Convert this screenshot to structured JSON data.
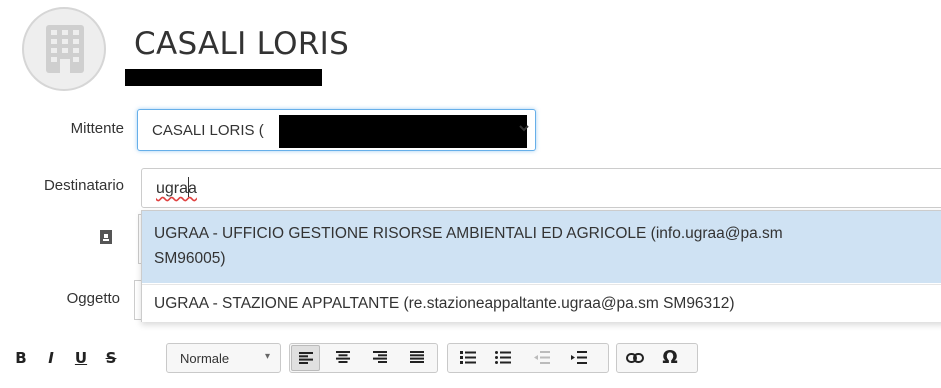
{
  "header": {
    "name": "CASALI LORIS",
    "avatar_icon": "building-icon"
  },
  "form": {
    "mittente_label": "Mittente",
    "mittente_value": "CASALI LORIS (",
    "destinatario_label": "Destinatario",
    "destinatario_value": "ugraa",
    "oggetto_label": "Oggetto"
  },
  "suggestions": [
    {
      "line1": "UGRAA - UFFICIO GESTIONE RISORSE AMBIENTALI ED AGRICOLE (info.ugraa@pa.sm",
      "line2": "SM96005)"
    },
    {
      "line1": "UGRAA - STAZIONE APPALTANTE (re.stazioneappaltante.ugraa@pa.sm SM96312)"
    }
  ],
  "toolbar": {
    "bold": "B",
    "italic": "I",
    "underline": "U",
    "strike": "S",
    "format_label": "Normale",
    "special_char": "Ω"
  },
  "colors": {
    "highlight": "#cfe2f3",
    "focus_border": "#66afe9"
  }
}
